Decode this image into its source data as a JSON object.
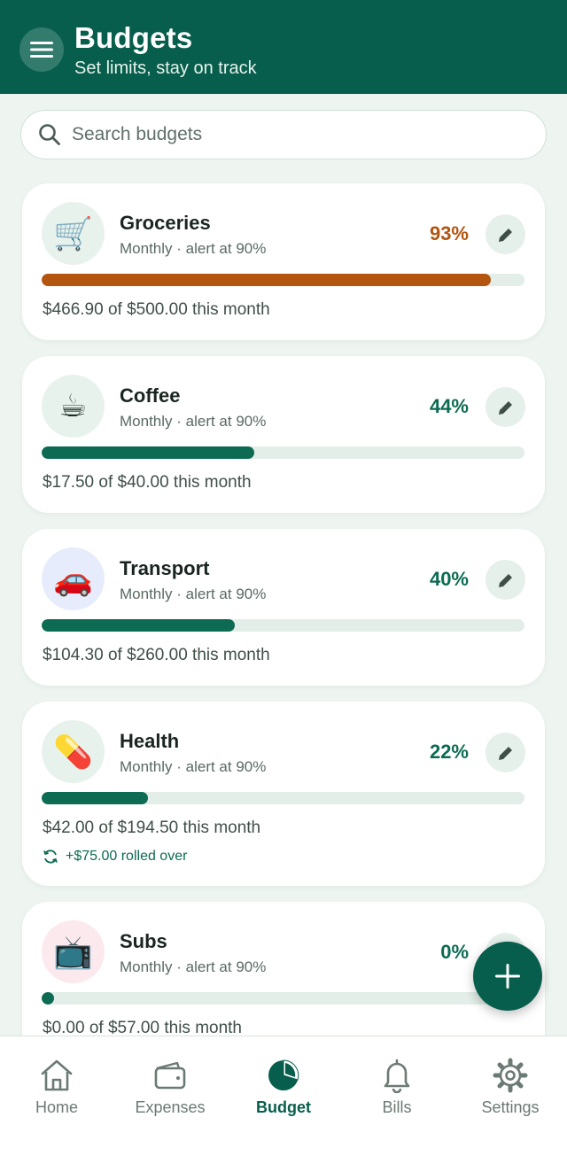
{
  "header": {
    "title": "Budgets",
    "subtitle": "Set limits, stay on track"
  },
  "search": {
    "placeholder": "Search budgets",
    "value": ""
  },
  "budgets": [
    {
      "icon": "🛒",
      "icon_name": "shopping-cart-icon",
      "name": "Groceries",
      "meta": "Monthly · alert at 90%",
      "percent_label": "93%",
      "progress": 0.93,
      "spent": "$466.90 of $500.00 this month",
      "status_color": "#b3540f"
    },
    {
      "icon": "☕",
      "icon_name": "coffee-icon",
      "name": "Coffee",
      "meta": "Monthly · alert at 90%",
      "percent_label": "44%",
      "progress": 0.44,
      "spent": "$17.50 of $40.00 this month",
      "status_color": "#0c6b52"
    },
    {
      "icon": "🚗",
      "icon_name": "car-icon",
      "name": "Transport",
      "meta": "Monthly · alert at 90%",
      "percent_label": "40%",
      "progress": 0.4,
      "spent": "$104.30 of $260.00 this month",
      "status_color": "#0c6b52"
    },
    {
      "icon": "💊",
      "icon_name": "pill-icon",
      "name": "Health",
      "meta": "Monthly · alert at 90%",
      "percent_label": "22%",
      "progress": 0.22,
      "spent": "$42.00 of $194.50 this month",
      "rollover": "+$75.00 rolled over",
      "status_color": "#0c6b52"
    },
    {
      "icon": "📺",
      "icon_name": "tv-icon",
      "name": "Subs",
      "meta": "Monthly · alert at 90%",
      "percent_label": "0%",
      "progress": 0.0,
      "spent": "$0.00 of $57.00 this month",
      "status_color": "#0c6b52"
    }
  ],
  "nav": {
    "items": [
      {
        "label": "Home",
        "icon": "home-icon",
        "active": false
      },
      {
        "label": "Expenses",
        "icon": "wallet-icon",
        "active": false
      },
      {
        "label": "Budget",
        "icon": "pie-chart-icon",
        "active": true
      },
      {
        "label": "Bills",
        "icon": "bell-icon",
        "active": false
      },
      {
        "label": "Settings",
        "icon": "gear-icon",
        "active": false
      }
    ]
  },
  "colors": {
    "brand": "#075e4c",
    "warning": "#b3540f",
    "ok": "#0c6b52"
  }
}
